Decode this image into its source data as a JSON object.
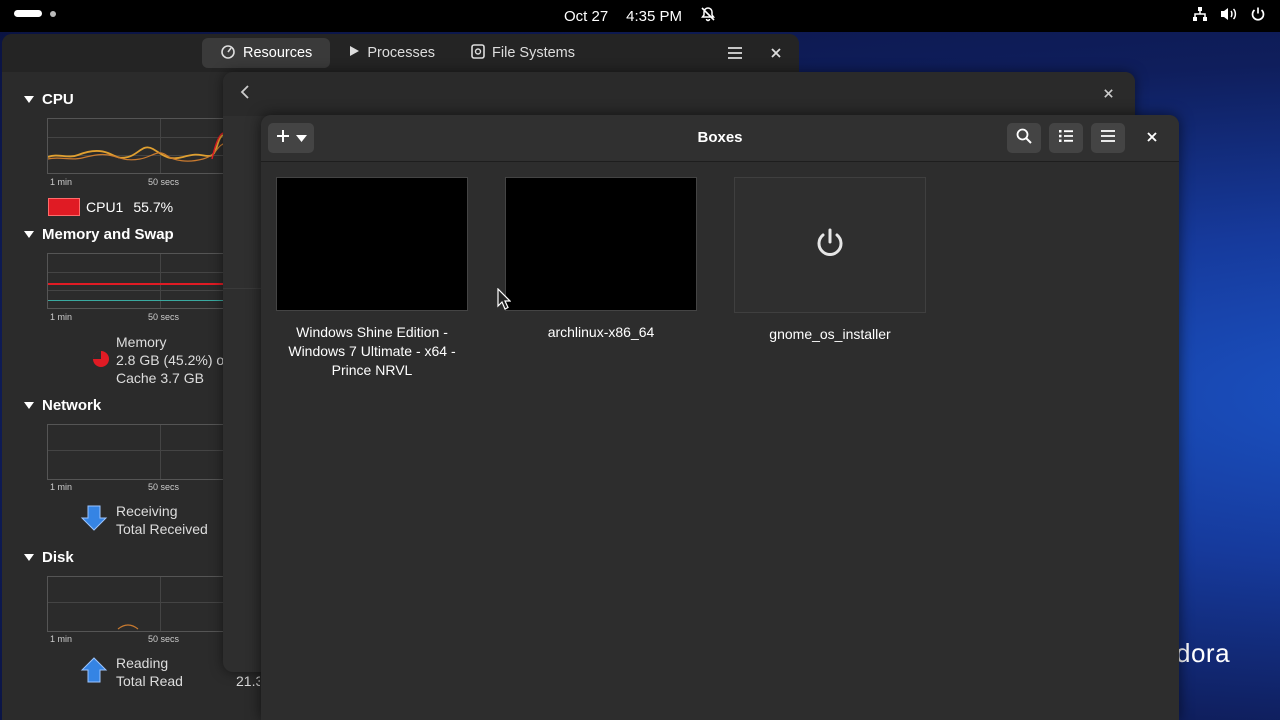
{
  "topbar": {
    "date": "Oct 27",
    "time": "4:35 PM",
    "icons": [
      "activities-indicator",
      "bell-muted-icon",
      "network-icon",
      "volume-icon",
      "power-icon"
    ]
  },
  "desktop": {
    "logo_text": "dora"
  },
  "system_monitor": {
    "tabs": [
      {
        "label": "Resources",
        "icon": "gauge-icon",
        "active": true
      },
      {
        "label": "Processes",
        "icon": "play-icon",
        "active": false
      },
      {
        "label": "File Systems",
        "icon": "disk-icon",
        "active": false
      }
    ],
    "sections": {
      "cpu": {
        "title": "CPU",
        "axis": [
          "1 min",
          "50 secs"
        ],
        "legend_label": "CPU1",
        "legend_value": "55.7%"
      },
      "memory": {
        "title": "Memory and Swap",
        "axis": [
          "1 min",
          "50 secs"
        ],
        "label": "Memory",
        "value": "2.8 GB (45.2%) o",
        "cache": "Cache 3.7 GB"
      },
      "network": {
        "title": "Network",
        "axis": [
          "1 min",
          "50 secs"
        ],
        "receiving": "Receiving",
        "total_received": "Total Received"
      },
      "disk": {
        "title": "Disk",
        "axis": [
          "1 min",
          "50 secs"
        ],
        "reading": "Reading",
        "total_read": "Total Read",
        "partial_value": "21.3"
      }
    }
  },
  "boxes": {
    "title": "Boxes",
    "machines": [
      {
        "name": "Windows Shine Edition - Windows 7 Ultimate - x64 - Prince NRVL",
        "state": "running"
      },
      {
        "name": "archlinux-x86_64",
        "state": "running"
      },
      {
        "name": "gnome_os_installer",
        "state": "off"
      }
    ]
  },
  "colors": {
    "cpu_line": "#e0a030",
    "memory_line": "#e01b24",
    "swap_line": "#3aa9a0",
    "arrow_blue": "#3584e4"
  }
}
